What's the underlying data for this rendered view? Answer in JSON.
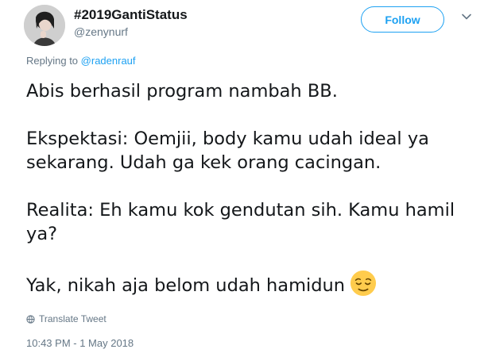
{
  "user": {
    "display_name": "#2019GantiStatus",
    "handle": "@zenynurf"
  },
  "follow_button": {
    "label": "Follow"
  },
  "replying": {
    "prefix": "Replying to",
    "mention": "@radenrauf"
  },
  "tweet": {
    "paragraphs": [
      "Abis berhasil program nambah BB.",
      "Ekspektasi: Oemjii, body kamu udah ideal ya sekarang. Udah ga kek orang cacingan.",
      "Realita: Eh kamu kok gendutan sih. Kamu hamil ya?",
      "Yak, nikah aja belom udah hamidun"
    ],
    "emoji": "relieved-face-emoji"
  },
  "translate": {
    "label": "Translate Tweet",
    "icon": "globe-icon"
  },
  "timestamp": "10:43 PM - 1 May 2018",
  "colors": {
    "accent": "#1da1f2",
    "secondary_text": "#657786",
    "primary_text": "#14171a"
  }
}
